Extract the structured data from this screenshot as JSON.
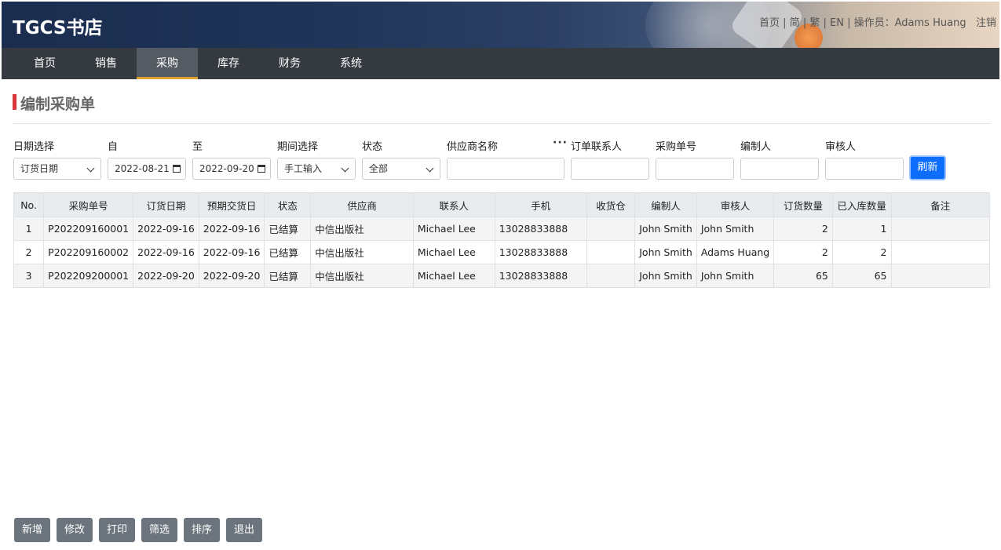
{
  "header": {
    "logo": "TGCS书店",
    "links": {
      "home": "首页",
      "simplified": "简",
      "traditional": "繁",
      "english": "EN",
      "operator_label": "操作员：",
      "operator_name": "Adams Huang",
      "logout": "注销"
    }
  },
  "nav": {
    "items": [
      {
        "label": "首页"
      },
      {
        "label": "销售"
      },
      {
        "label": "采购"
      },
      {
        "label": "库存"
      },
      {
        "label": "财务"
      },
      {
        "label": "系统"
      }
    ],
    "active_index": 2,
    "active_color": "#e0a030"
  },
  "page": {
    "title": "编制采购单",
    "title_accent": "#d9363e"
  },
  "filters": {
    "date_type": {
      "label": "日期选择",
      "value": "订货日期"
    },
    "from": {
      "label": "自",
      "value": "2022-08-21"
    },
    "to": {
      "label": "至",
      "value": "2022-09-20"
    },
    "period": {
      "label": "期间选择",
      "value": "手工输入"
    },
    "status": {
      "label": "状态",
      "value": "全部"
    },
    "supplier": {
      "label": "供应商名称",
      "value": ""
    },
    "contact": {
      "label": "订单联系人",
      "value": ""
    },
    "po_number": {
      "label": "采购单号",
      "value": ""
    },
    "creator": {
      "label": "编制人",
      "value": ""
    },
    "approver": {
      "label": "审核人",
      "value": ""
    },
    "more_icon": "ellipsis-icon",
    "refresh_label": "刷新",
    "refresh_color": "#0d6efd"
  },
  "table": {
    "headers": [
      "No.",
      "采购单号",
      "订货日期",
      "预期交货日",
      "状态",
      "供应商",
      "联系人",
      "手机",
      "收货仓",
      "编制人",
      "审核人",
      "订货数量",
      "已入库数量",
      "备注"
    ],
    "rows": [
      [
        "1",
        "P202209160001",
        "2022-09-16",
        "2022-09-16",
        "已结算",
        "中信出版社",
        "Michael Lee",
        "13028833888",
        "",
        "John Smith",
        "John Smith",
        "2",
        "1",
        ""
      ],
      [
        "2",
        "P202209160002",
        "2022-09-16",
        "2022-09-16",
        "已结算",
        "中信出版社",
        "Michael Lee",
        "13028833888",
        "",
        "John Smith",
        "Adams Huang",
        "2",
        "2",
        ""
      ],
      [
        "3",
        "P202209200001",
        "2022-09-20",
        "2022-09-20",
        "已结算",
        "中信出版社",
        "Michael Lee",
        "13028833888",
        "",
        "John Smith",
        "John Smith",
        "65",
        "65",
        ""
      ]
    ]
  },
  "actions": {
    "add": "新增",
    "edit": "修改",
    "print": "打印",
    "filter": "筛选",
    "sort": "排序",
    "exit": "退出",
    "button_color": "#6c757d"
  }
}
